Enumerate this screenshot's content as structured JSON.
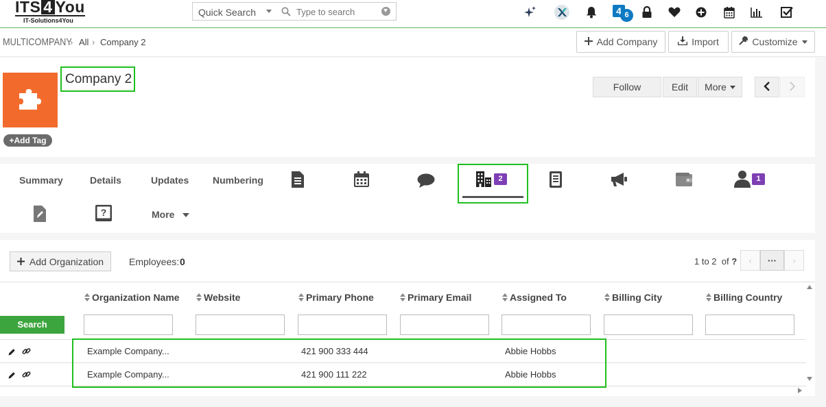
{
  "topbar": {
    "logo_main_a": "ITS",
    "logo_main_b": "4",
    "logo_main_c": "You",
    "logo_sub": "IT-Solutions4You",
    "quick_search_label": "Quick Search",
    "search_placeholder": "Type to search",
    "notifications_count": "6"
  },
  "breadcrumb": {
    "module": "MULTICOMPANY",
    "filter": "All",
    "record": "Company 2"
  },
  "header_buttons": {
    "add": "Add Company",
    "import": "Import",
    "customize": "Customize"
  },
  "record": {
    "name": "Company 2",
    "add_tag": "Add Tag",
    "follow": "Follow",
    "edit": "Edit",
    "more": "More"
  },
  "tabs": {
    "summary": "Summary",
    "details": "Details",
    "updates": "Updates",
    "numbering": "Numbering",
    "organizations_count": "2",
    "contacts_count": "1",
    "more": "More"
  },
  "related": {
    "add_button": "Add Organization",
    "employees_label": "Employees:",
    "employees_value": "0",
    "pager_text": "1 to 2",
    "pager_of": "of",
    "pager_total": "?",
    "pager_dots": "···",
    "search_button": "Search",
    "columns": [
      "Organization Name",
      "Website",
      "Primary Phone",
      "Primary Email",
      "Assigned To",
      "Billing City",
      "Billing Country"
    ],
    "rows": [
      {
        "name": "Example Company...",
        "website": "",
        "phone": "421 900 333 444",
        "email": "",
        "assigned": "Abbie Hobbs",
        "city": "",
        "country": ""
      },
      {
        "name": "Example Company...",
        "website": "",
        "phone": "421 900 111 222",
        "email": "",
        "assigned": "Abbie Hobbs",
        "city": "",
        "country": ""
      }
    ]
  },
  "colors": {
    "accent_green": "#3da53d",
    "highlight_green": "#1fbf1f",
    "avatar_orange": "#f26b2d",
    "badge_purple": "#7e3fb5",
    "badge_blue": "#0e7ac4"
  }
}
